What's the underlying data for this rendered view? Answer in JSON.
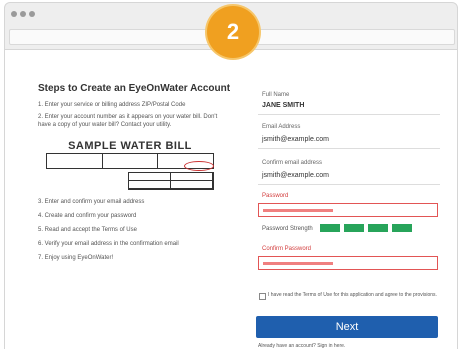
{
  "step_number": "2",
  "left": {
    "title": "Steps to Create an EyeOnWater Account",
    "steps": [
      "1. Enter your service or billing address ZIP/Postal Code",
      "2. Enter your account number as it appears on your water bill. Don't have a copy of your water bill? Contact your utility.",
      "3. Enter and confirm your email address",
      "4. Create and confirm your password",
      "5. Read and accept the Terms of Use",
      "6. Verify your email address in the confirmation email",
      "7. Enjoy using EyeOnWater!"
    ],
    "bill_title": "SAMPLE WATER BILL"
  },
  "form": {
    "full_name_label": "Full Name",
    "full_name_value": "JANE SMITH",
    "email_label": "Email Address",
    "email_value": "jsmith@example.com",
    "confirm_email_label": "Confirm email address",
    "confirm_email_value": "jsmith@example.com",
    "password_label": "Password",
    "password_strength_label": "Password Strength",
    "confirm_password_label": "Confirm Password",
    "terms_text": "I have read the Terms of Use for this application and agree to the provisions.",
    "next_label": "Next",
    "signin_text": "Already have an account? Sign in here."
  },
  "colors": {
    "step_badge": "#f0a020",
    "next_button": "#1f5fae",
    "strength_bar": "#27a45a",
    "error": "#e25555"
  }
}
